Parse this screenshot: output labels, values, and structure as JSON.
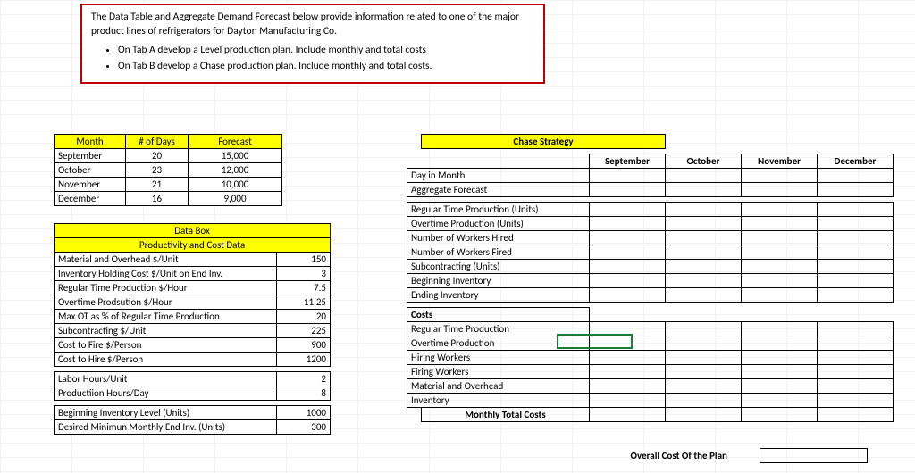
{
  "instructions": {
    "line1": "The Data Table and Aggregate Demand Forecast below provide information related to one of the major product lines of refrigerators for Dayton Manufacturing Co.",
    "bullet1": "On Tab A develop a Level production plan. Include monthly and total costs",
    "bullet2": "On Tab B develop a Chase production plan. Include monthly and total costs."
  },
  "forecast": {
    "headers": {
      "month": "Month",
      "days": "# of Days",
      "forecast": "Forecast"
    },
    "rows": [
      {
        "month": "September",
        "days": "20",
        "forecast": "15,000"
      },
      {
        "month": "October",
        "days": "23",
        "forecast": "12,000"
      },
      {
        "month": "November",
        "days": "21",
        "forecast": "10,000"
      },
      {
        "month": "December",
        "days": "16",
        "forecast": "9,000"
      }
    ]
  },
  "databox": {
    "title1": "Data Box",
    "title2": "Productivity and Cost Data",
    "rows1": [
      {
        "label": "Material and Overhead  $/Unit",
        "value": "150"
      },
      {
        "label": "Inventory Holding Cost  $/Unit on End Inv.",
        "value": "3"
      },
      {
        "label": "Regular Time Production  $/Hour",
        "value": "7.5"
      },
      {
        "label": "Overtime Prodsution  $/Hour",
        "value": "11.25"
      },
      {
        "label": "Max OT as % of Regular Time Production",
        "value": "20"
      },
      {
        "label": "Subcontracting  $/Unit",
        "value": "225"
      },
      {
        "label": "Cost to Fire  $/Person",
        "value": "900"
      },
      {
        "label": "Cost to Hire $/Person",
        "value": "1200"
      }
    ],
    "rows2": [
      {
        "label": "Labor Hours/Unit",
        "value": "2"
      },
      {
        "label": "Productiion Hours/Day",
        "value": "8"
      }
    ],
    "rows3": [
      {
        "label": "Beginning Inventory Level (Units)",
        "value": "1000"
      },
      {
        "label": "Desired Minimun Monthly End Inv. (Units)",
        "value": "300"
      }
    ]
  },
  "chase": {
    "title": "Chase Strategy",
    "months": [
      "September",
      "October",
      "November",
      "December"
    ],
    "rows_top": [
      "Day in Month",
      "Aggregate Forecast"
    ],
    "rows_mid": [
      "Regular Time Production (Units)",
      "Overtime Production (Units)",
      "Number of Workers Hired",
      "Number of Workers Fired",
      "Subcontracting (Units)",
      "Beginning Inventory",
      "Ending Inventory"
    ],
    "costs_title": "Costs",
    "rows_cost": [
      "Regular Time Production",
      "Overtime Production",
      "Hiring Workers",
      "Firing Workers",
      "Material and Overhead",
      "Inventory"
    ],
    "monthly_total": "Monthly Total Costs",
    "overall_label": "Overall Cost Of the Plan"
  },
  "chart_data": {
    "type": "table",
    "forecast_table": {
      "columns": [
        "Month",
        "# of Days",
        "Forecast"
      ],
      "rows": [
        [
          "September",
          20,
          15000
        ],
        [
          "October",
          23,
          12000
        ],
        [
          "November",
          21,
          10000
        ],
        [
          "December",
          16,
          9000
        ]
      ]
    },
    "cost_parameters": {
      "material_overhead_per_unit": 150,
      "inventory_holding_cost_per_unit_end_inv": 3,
      "regular_time_production_per_hour": 7.5,
      "overtime_production_per_hour": 11.25,
      "max_ot_pct_of_regular": 20,
      "subcontracting_per_unit": 225,
      "cost_to_fire_per_person": 900,
      "cost_to_hire_per_person": 1200,
      "labor_hours_per_unit": 2,
      "production_hours_per_day": 8,
      "beginning_inventory_units": 1000,
      "desired_min_monthly_end_inv_units": 300
    }
  }
}
